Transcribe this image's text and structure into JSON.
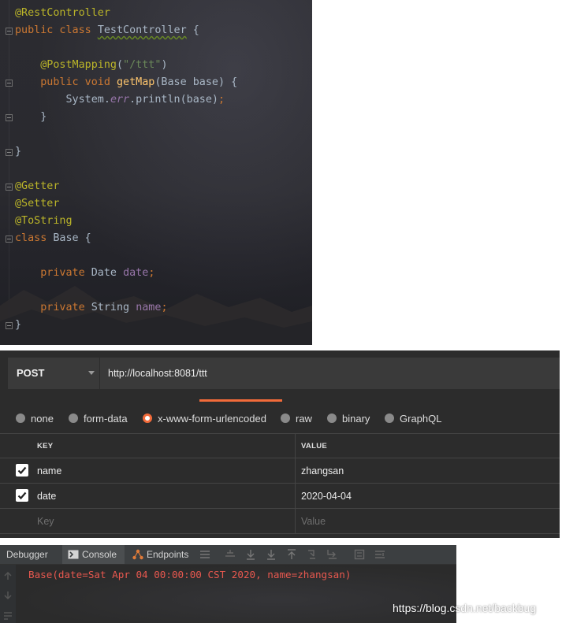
{
  "code_editor": {
    "lines": [
      {
        "fold": false,
        "tokens": [
          {
            "c": "ann",
            "t": "@RestController"
          }
        ]
      },
      {
        "fold": true,
        "tokens": [
          {
            "c": "kw",
            "t": "public class "
          },
          {
            "c": "cls",
            "t": "TestController"
          },
          {
            "c": "pl",
            "t": " {"
          }
        ]
      },
      {
        "fold": false,
        "tokens": []
      },
      {
        "fold": false,
        "tokens": [
          {
            "c": "pl",
            "t": "    "
          },
          {
            "c": "ann",
            "t": "@PostMapping"
          },
          {
            "c": "pl",
            "t": "("
          },
          {
            "c": "str",
            "t": "\"/ttt\""
          },
          {
            "c": "pl",
            "t": ")"
          }
        ]
      },
      {
        "fold": true,
        "tokens": [
          {
            "c": "pl",
            "t": "    "
          },
          {
            "c": "kw",
            "t": "public void "
          },
          {
            "c": "fn",
            "t": "getMap"
          },
          {
            "c": "pl",
            "t": "(Base base) {"
          }
        ]
      },
      {
        "fold": false,
        "tokens": [
          {
            "c": "pl",
            "t": "        System."
          },
          {
            "c": "fldi",
            "t": "err"
          },
          {
            "c": "pl",
            "t": ".println(base)"
          },
          {
            "c": "kw",
            "t": ";"
          }
        ]
      },
      {
        "fold": true,
        "tokens": [
          {
            "c": "pl",
            "t": "    }"
          }
        ]
      },
      {
        "fold": false,
        "tokens": []
      },
      {
        "fold": true,
        "tokens": [
          {
            "c": "pl",
            "t": "}"
          }
        ]
      },
      {
        "fold": false,
        "tokens": []
      },
      {
        "fold": true,
        "tokens": [
          {
            "c": "ann",
            "t": "@Getter"
          }
        ]
      },
      {
        "fold": false,
        "tokens": [
          {
            "c": "ann",
            "t": "@Setter"
          }
        ]
      },
      {
        "fold": false,
        "tokens": [
          {
            "c": "ann",
            "t": "@ToString"
          }
        ]
      },
      {
        "fold": true,
        "tokens": [
          {
            "c": "kw",
            "t": "class "
          },
          {
            "c": "pl",
            "t": "Base {"
          }
        ]
      },
      {
        "fold": false,
        "tokens": []
      },
      {
        "fold": false,
        "tokens": [
          {
            "c": "pl",
            "t": "    "
          },
          {
            "c": "kw",
            "t": "private "
          },
          {
            "c": "pl",
            "t": "Date "
          },
          {
            "c": "fld",
            "t": "date"
          },
          {
            "c": "kw",
            "t": ";"
          }
        ]
      },
      {
        "fold": false,
        "tokens": []
      },
      {
        "fold": false,
        "tokens": [
          {
            "c": "pl",
            "t": "    "
          },
          {
            "c": "kw",
            "t": "private "
          },
          {
            "c": "pl",
            "t": "String "
          },
          {
            "c": "fld",
            "t": "name"
          },
          {
            "c": "kw",
            "t": ";"
          }
        ]
      },
      {
        "fold": true,
        "tokens": [
          {
            "c": "pl",
            "t": "}"
          }
        ]
      }
    ]
  },
  "request": {
    "method": "POST",
    "url": "http://localhost:8081/ttt"
  },
  "body_types": {
    "options": [
      "none",
      "form-data",
      "x-www-form-urlencoded",
      "raw",
      "binary",
      "GraphQL"
    ],
    "selected": "x-www-form-urlencoded"
  },
  "params_table": {
    "headers": {
      "key": "KEY",
      "value": "VALUE"
    },
    "rows": [
      {
        "checked": true,
        "key": "name",
        "value": "zhangsan"
      },
      {
        "checked": true,
        "key": "date",
        "value": "2020-04-04"
      }
    ],
    "placeholder": {
      "key": "Key",
      "value": "Value"
    }
  },
  "debugger": {
    "tabs": {
      "debugger": "Debugger",
      "console": "Console",
      "endpoints": "Endpoints"
    },
    "output": "Base(date=Sat Apr 04 00:00:00 CST 2020, name=zhangsan)"
  },
  "watermark": "https://blog.csdn.net/backbug",
  "colors": {
    "accent": "#f26b3a",
    "console_error": "#e8584f",
    "annotation": "#bbb529",
    "keyword": "#cc7832"
  }
}
